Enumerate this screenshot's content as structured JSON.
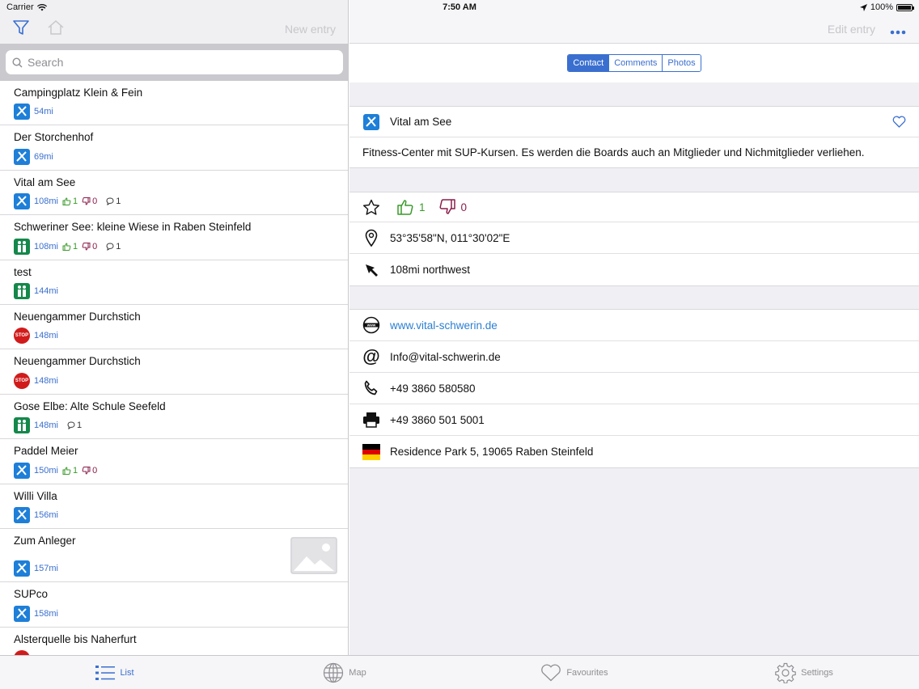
{
  "status": {
    "carrier": "Carrier",
    "time": "7:50 AM",
    "battery": "100%"
  },
  "left_nav": {
    "new_entry": "New entry"
  },
  "search": {
    "placeholder": "Search"
  },
  "list": [
    {
      "title": "Campingplatz Klein & Fein",
      "dist": "54mi",
      "type": "blue"
    },
    {
      "title": "Der Storchenhof",
      "dist": "69mi",
      "type": "blue"
    },
    {
      "title": "Vital am See",
      "dist": "108mi",
      "type": "blue",
      "up": "1",
      "down": "0",
      "comments": "1"
    },
    {
      "title": "Schweriner See: kleine Wiese in Raben Steinfeld",
      "dist": "108mi",
      "type": "green",
      "up": "1",
      "down": "0",
      "comments": "1"
    },
    {
      "title": "test",
      "dist": "144mi",
      "type": "green"
    },
    {
      "title": "Neuengammer Durchstich",
      "dist": "148mi",
      "type": "red"
    },
    {
      "title": "Neuengammer Durchstich",
      "dist": "148mi",
      "type": "red"
    },
    {
      "title": "Gose Elbe: Alte Schule Seefeld",
      "dist": "148mi",
      "type": "green",
      "comments": "1"
    },
    {
      "title": "Paddel Meier",
      "dist": "150mi",
      "type": "blue",
      "up": "1",
      "down": "0"
    },
    {
      "title": "Willi Villa",
      "dist": "156mi",
      "type": "blue"
    },
    {
      "title": "Zum Anleger",
      "dist": "157mi",
      "type": "blue",
      "thumb": true
    },
    {
      "title": "SUPco",
      "dist": "158mi",
      "type": "blue"
    },
    {
      "title": "Alsterquelle bis Naherfurt",
      "dist": "",
      "type": "red"
    }
  ],
  "right_nav": {
    "edit_entry": "Edit entry"
  },
  "segments": [
    "Contact",
    "Comments",
    "Photos"
  ],
  "detail": {
    "name": "Vital am See",
    "description": "Fitness-Center mit SUP-Kursen. Es werden die Boards auch an Mitglieder und Nichmitglieder verliehen.",
    "up": "1",
    "down": "0",
    "coords": "53°35'58\"N, 011°30'02\"E",
    "direction": "108mi northwest",
    "website": "www.vital-schwerin.de",
    "email": "Info@vital-schwerin.de",
    "phone": "+49 3860 580580",
    "fax": "+49 3860 501 5001",
    "address": "Residence Park 5, 19065 Raben Steinfeld"
  },
  "tabs": [
    "List",
    "Map",
    "Favourites",
    "Settings"
  ]
}
